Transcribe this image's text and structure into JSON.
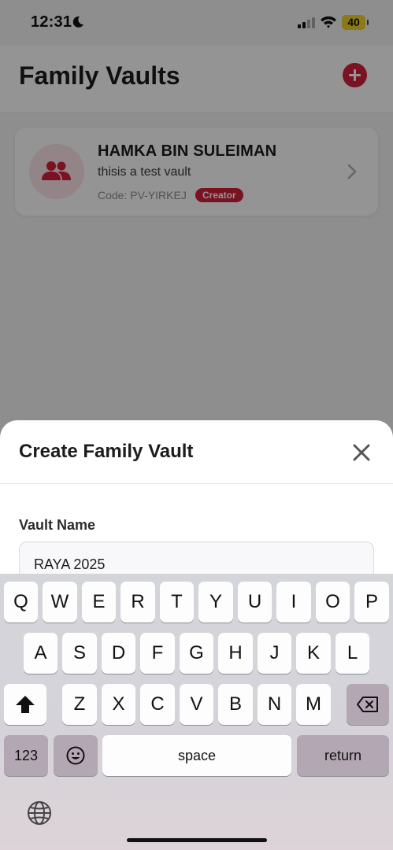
{
  "status": {
    "time": "12:31",
    "battery": "40"
  },
  "header": {
    "title": "Family Vaults"
  },
  "vault_card": {
    "name": "HAMKA BIN SULEIMAN",
    "description": "thisis a test vault",
    "code": "Code: PV-YIRKEJ",
    "badge": "Creator"
  },
  "modal": {
    "title": "Create Family Vault",
    "field_label": "Vault Name",
    "field_value": "RAYA 2025"
  },
  "keyboard": {
    "row1": [
      "Q",
      "W",
      "E",
      "R",
      "T",
      "Y",
      "U",
      "I",
      "O",
      "P"
    ],
    "row2": [
      "A",
      "S",
      "D",
      "F",
      "G",
      "H",
      "J",
      "K",
      "L"
    ],
    "row3": [
      "Z",
      "X",
      "C",
      "V",
      "B",
      "N",
      "M"
    ],
    "numbers_label": "123",
    "space_label": "space",
    "return_label": "return"
  },
  "colors": {
    "accent": "#d21f3c",
    "badge_bg": "#d21f3c",
    "avatar_bg": "#fbe4e8"
  }
}
